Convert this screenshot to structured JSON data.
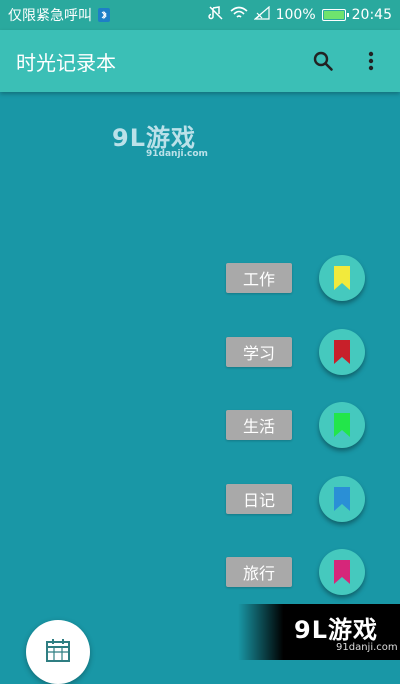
{
  "status_bar": {
    "carrier": "仅限紧急呼叫",
    "bluetooth_icon": "bluetooth-icon",
    "battery_percent": "100%",
    "battery_level": 1.0,
    "time": "20:45",
    "icons": [
      "mute-icon",
      "wifi-icon",
      "no-signal-icon",
      "battery-charging-icon"
    ]
  },
  "app_bar": {
    "title": "时光记录本",
    "actions": [
      "search-icon",
      "more-vert-icon"
    ]
  },
  "watermark_top": {
    "text": "9L游戏",
    "url": "91danji.com"
  },
  "categories": [
    {
      "label": "工作",
      "icon": "bookmark-icon",
      "color": "#f2ea3c"
    },
    {
      "label": "学习",
      "icon": "bookmark-icon",
      "color": "#c8202a"
    },
    {
      "label": "生活",
      "icon": "bookmark-icon",
      "color": "#22e64a"
    },
    {
      "label": "日记",
      "icon": "bookmark-icon",
      "color": "#2a8fd6"
    },
    {
      "label": "旅行",
      "icon": "bookmark-icon",
      "color": "#d6267a"
    }
  ],
  "bottom_fab": {
    "icon": "calendar-icon"
  },
  "watermark_bottom": {
    "text": "9L游戏",
    "url": "91danji.com"
  },
  "colors": {
    "background": "#1997a6",
    "app_bar": "#3bbfb6",
    "status_bar": "#2aa99e",
    "fab": "#45c9be",
    "label_bg": "#a9a9a9"
  }
}
